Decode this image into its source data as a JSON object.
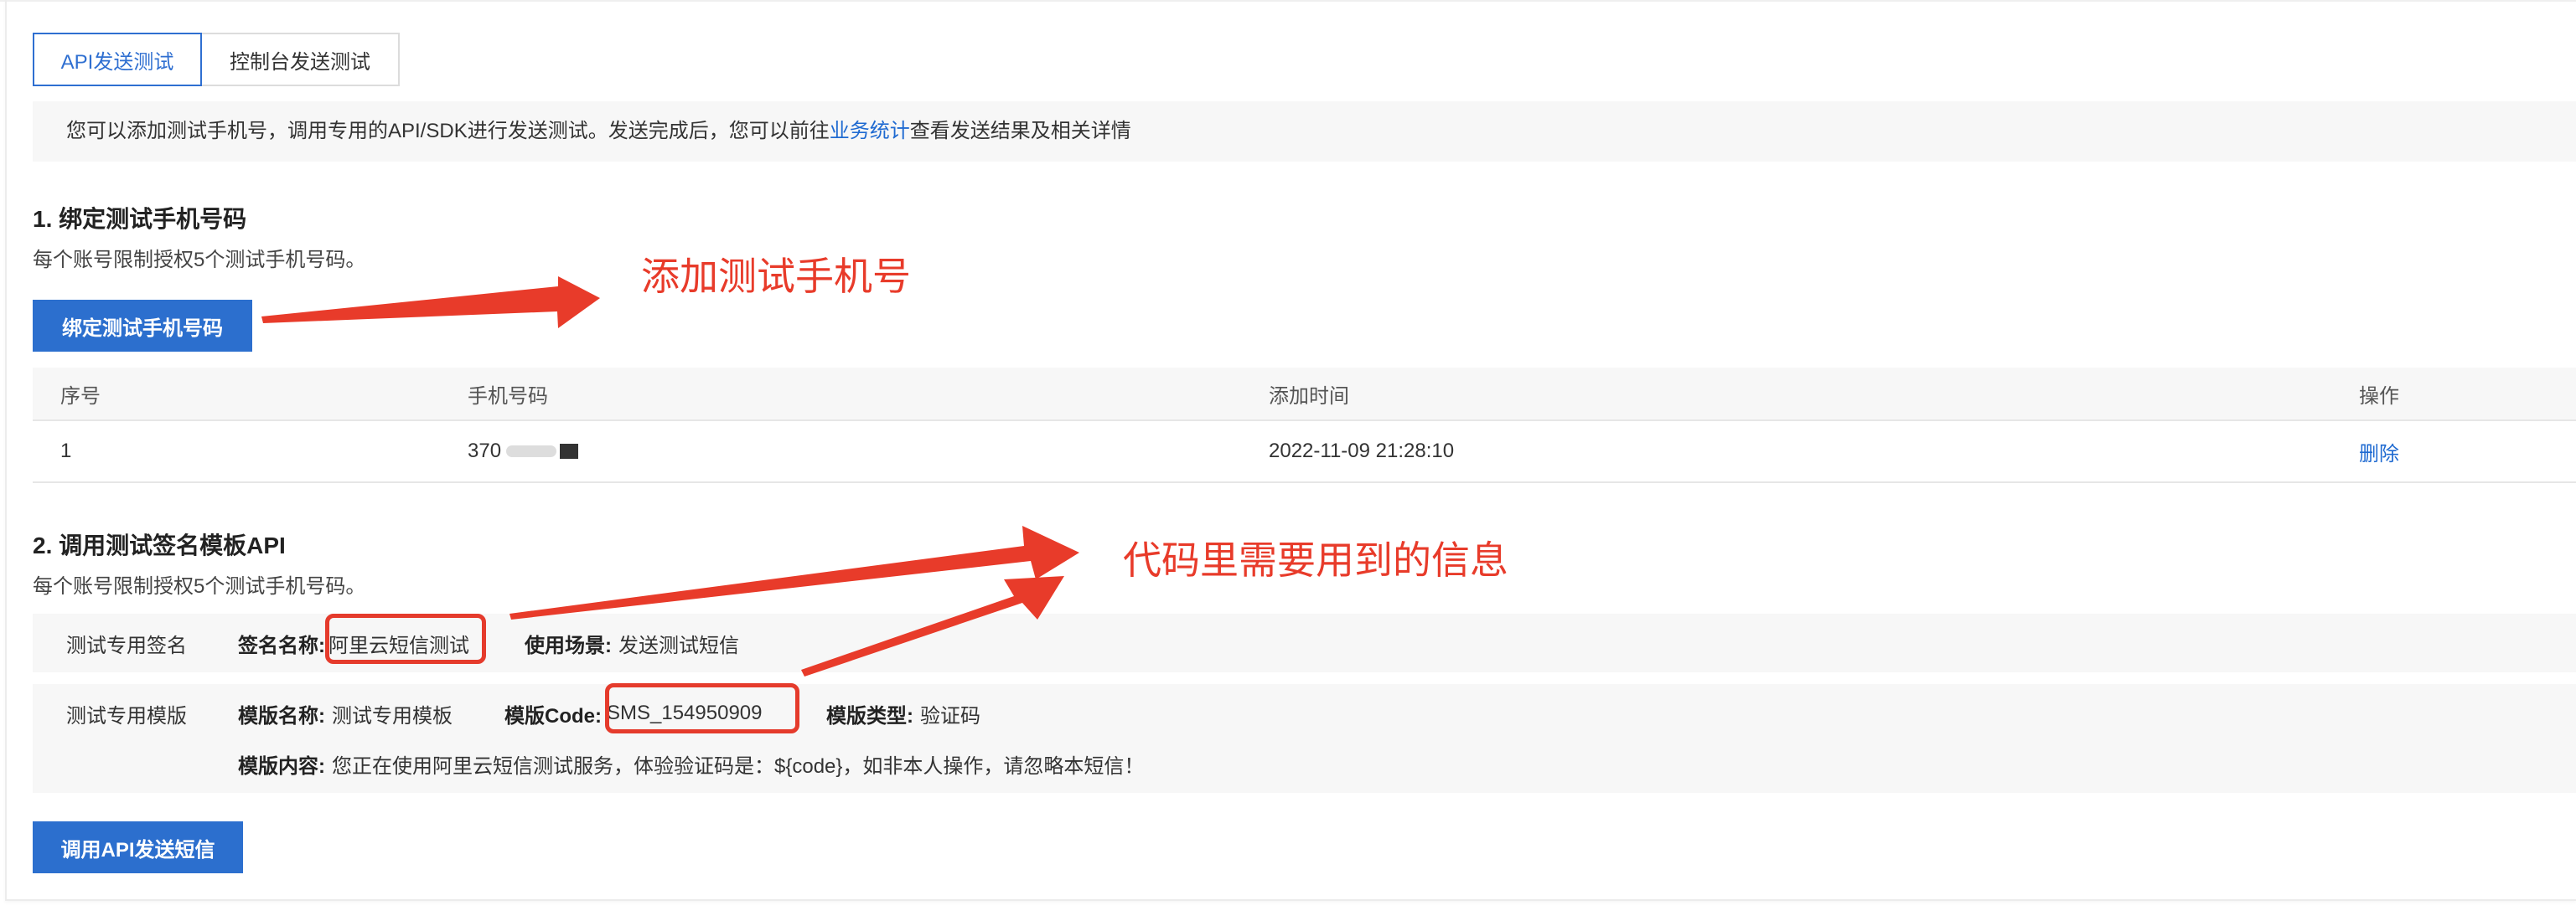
{
  "tabs": [
    {
      "label": "API发送测试",
      "active": true
    },
    {
      "label": "控制台发送测试",
      "active": false
    }
  ],
  "info": {
    "prefix": "您可以添加测试手机号，调用专用的API/SDK进行发送测试。发送完成后，您可以前往",
    "link": "业务统计",
    "suffix": "查看发送结果及相关详情"
  },
  "section1": {
    "title": "1. 绑定测试手机号码",
    "desc": "每个账号限制授权5个测试手机号码。",
    "button": "绑定测试手机号码"
  },
  "table": {
    "headers": [
      "序号",
      "手机号码",
      "添加时间",
      "操作"
    ],
    "rows": [
      {
        "index": "1",
        "phone": "370",
        "time": "2022-11-09 21:28:10",
        "action": "删除"
      }
    ]
  },
  "section2": {
    "title": "2. 调用测试签名模板API",
    "desc": "每个账号限制授权5个测试手机号码。",
    "button": "调用API发送短信"
  },
  "signature": {
    "row_label": "测试专用签名",
    "name_label": "签名名称:",
    "name_value": "阿里云短信测试",
    "scene_label": "使用场景:",
    "scene_value": "发送测试短信"
  },
  "template": {
    "row_label": "测试专用模版",
    "name_label": "模版名称:",
    "name_value": "测试专用模板",
    "code_label": "模版Code:",
    "code_value": "SMS_154950909",
    "type_label": "模版类型:",
    "type_value": "验证码",
    "content_label": "模版内容:",
    "content_value": "您正在使用阿里云短信测试服务，体验验证码是：${code}，如非本人操作，请忽略本短信！"
  },
  "annotations": {
    "add_phone": "添加测试手机号",
    "needed_info": "代码里需要用到的信息"
  },
  "colors": {
    "primary": "#2c6fce",
    "link": "#1f6ad1",
    "annotation": "#e83b2a"
  }
}
